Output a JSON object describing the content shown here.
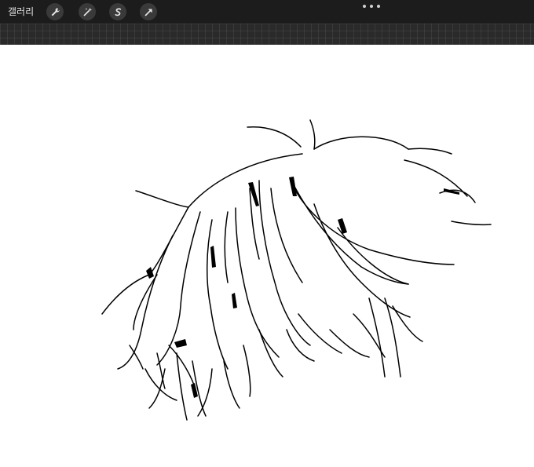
{
  "toolbar": {
    "gallery_label": "갤러리",
    "tools": [
      {
        "name": "wrench-icon"
      },
      {
        "name": "magic-wand-icon"
      },
      {
        "name": "selection-s-icon"
      },
      {
        "name": "transform-arrow-icon"
      }
    ],
    "more_icon": "ellipsis-icon"
  },
  "colors": {
    "toolbar_bg": "#1c1c1c",
    "canvas_bg": "#ffffff",
    "ink": "#000000"
  },
  "canvas": {
    "content": "hair-sketch-lineart"
  }
}
